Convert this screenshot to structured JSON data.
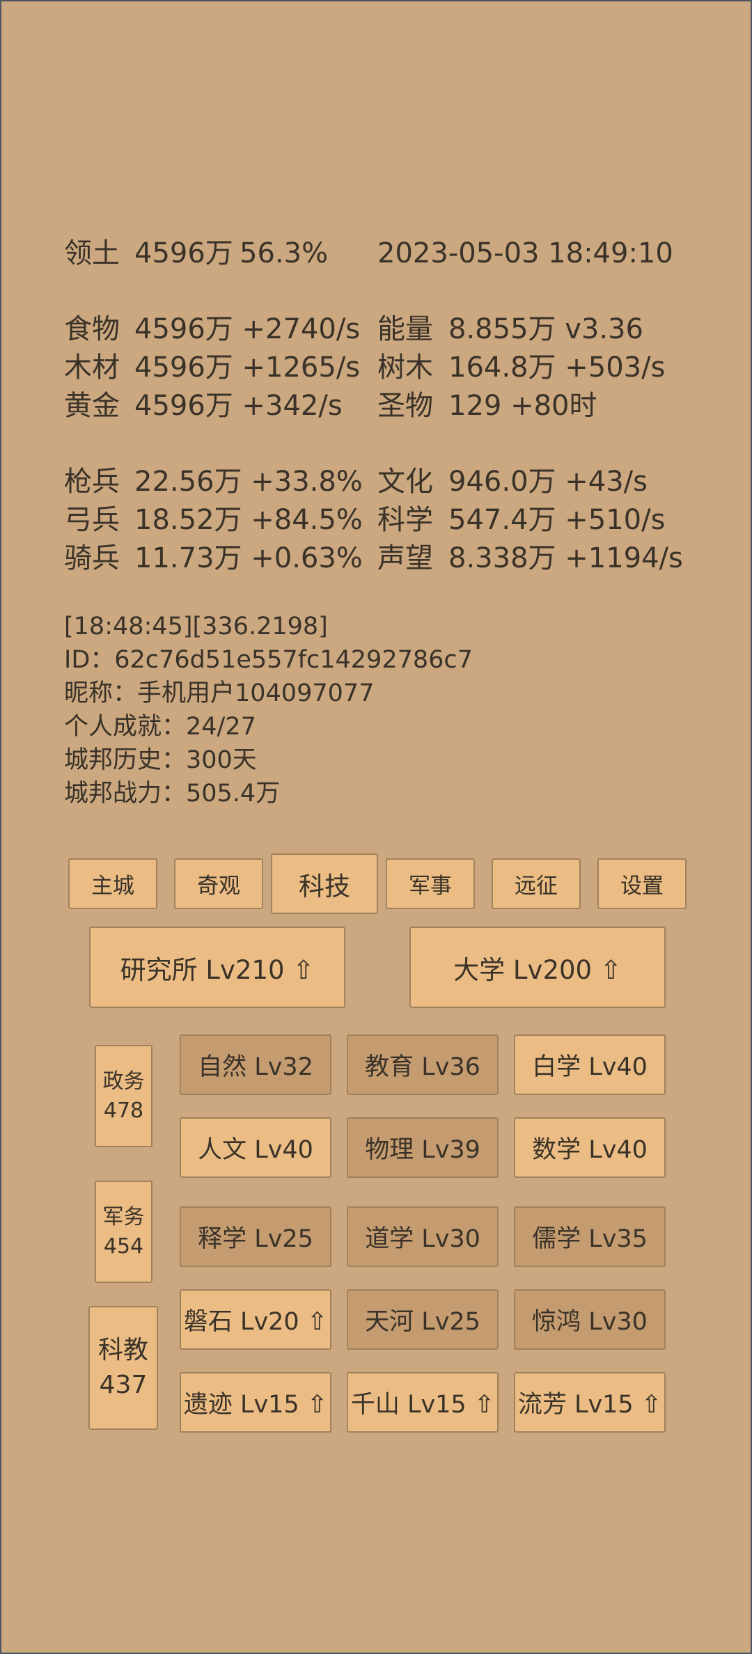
{
  "territory": {
    "label": "领土",
    "value": "4596万",
    "percent": "56.3%",
    "datetime": "2023-05-03 18:49:10"
  },
  "resources": [
    {
      "label": "食物",
      "value": "4596万 +2740/s",
      "label2": "能量",
      "value2": "8.855万  v3.36"
    },
    {
      "label": "木材",
      "value": "4596万 +1265/s",
      "label2": "树木",
      "value2": "164.8万 +503/s"
    },
    {
      "label": "黄金",
      "value": "4596万 +342/s",
      "label2": "圣物",
      "value2": "129 +80时"
    }
  ],
  "units": [
    {
      "label": "枪兵",
      "value": "22.56万 +33.8%",
      "label2": "文化",
      "value2": "946.0万 +43/s"
    },
    {
      "label": "弓兵",
      "value": "18.52万 +84.5%",
      "label2": "科学",
      "value2": "547.4万 +510/s"
    },
    {
      "label": "骑兵",
      "value": "11.73万 +0.63%",
      "label2": "声望",
      "value2": "8.338万 +1194/s"
    }
  ],
  "info": {
    "log": "[18:48:45][336.2198]",
    "id": "ID：62c76d51e557fc14292786c7",
    "nickname": "昵称：手机用户104097077",
    "achievement": "个人成就：24/27",
    "history": "城邦历史：300天",
    "power": "城邦战力：505.4万"
  },
  "tabs": [
    "主城",
    "奇观",
    "科技",
    "军事",
    "远征",
    "设置"
  ],
  "active_tab": "科技",
  "buildings": [
    "研究所 Lv210 ⇧",
    "大学 Lv200 ⇧"
  ],
  "categories": [
    {
      "name": "政务",
      "count": "478"
    },
    {
      "name": "军务",
      "count": "454"
    },
    {
      "name": "科教",
      "count": "437"
    }
  ],
  "skills": [
    [
      "自然 Lv32",
      "教育 Lv36",
      "白学 Lv40"
    ],
    [
      "人文 Lv40",
      "物理 Lv39",
      "数学 Lv40"
    ],
    [
      "释学 Lv25",
      "道学 Lv30",
      "儒学 Lv35"
    ],
    [
      "磐石 Lv20 ⇧",
      "天河 Lv25",
      "惊鸿 Lv30"
    ],
    [
      "遗迹 Lv15 ⇧",
      "千山 Lv15 ⇧",
      "流芳 Lv15 ⇧"
    ]
  ],
  "colors": {
    "background": "#cba880",
    "button_light": "#ebbd84",
    "button_dark": "#c49c70",
    "text": "#3a3228"
  }
}
